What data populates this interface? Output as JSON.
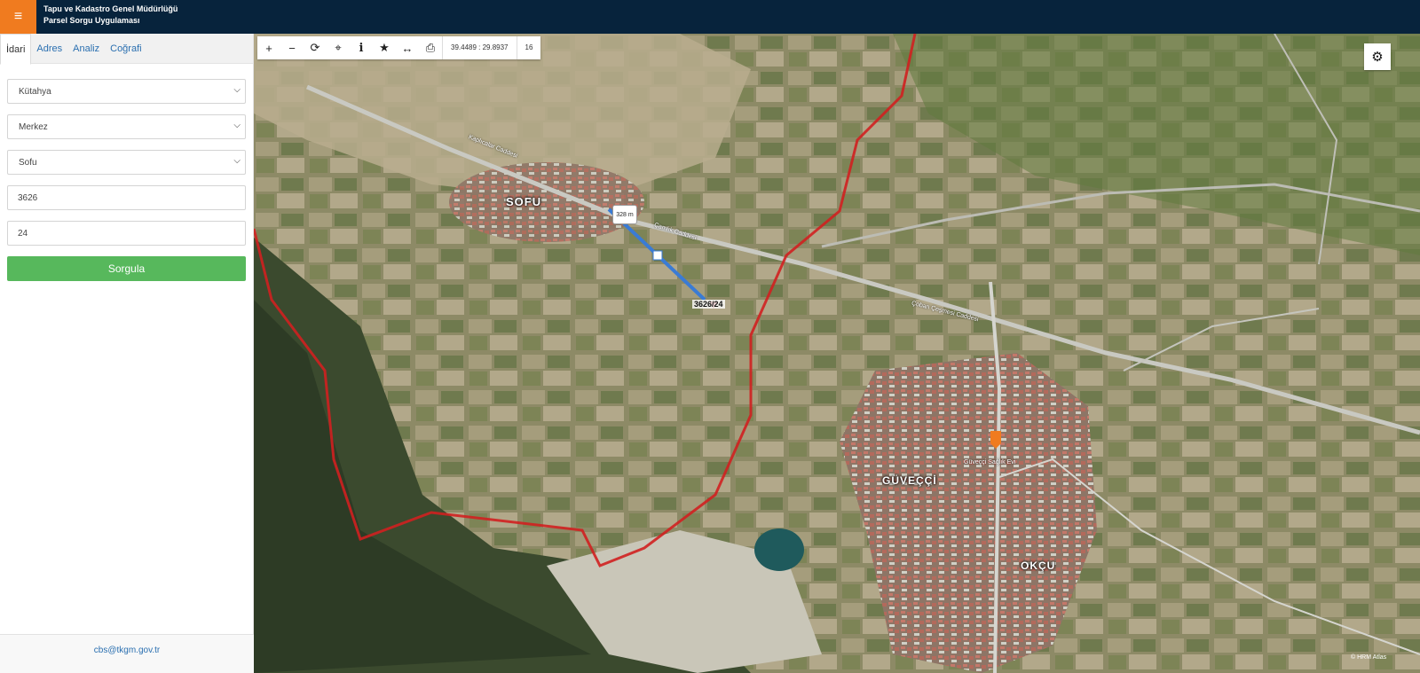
{
  "header": {
    "title_line1": "Tapu ve Kadastro Genel Müdürlüğü",
    "title_line2": "Parsel Sorgu Uygulaması",
    "menu_icon": "hamburger-icon"
  },
  "sidebar": {
    "tabs": [
      {
        "label": "İdari"
      },
      {
        "label": "Adres"
      },
      {
        "label": "Analiz"
      },
      {
        "label": "Coğrafi"
      }
    ],
    "il": "Kütahya",
    "ilce": "Merkez",
    "mahalle": "Sofu",
    "ada": "3626",
    "parsel": "24",
    "submit_label": "Sorgula",
    "footer_email": "cbs@tkgm.gov.tr"
  },
  "toolbar": {
    "coordinates": "39.4489 : 29.8937",
    "zoom_level": "16"
  },
  "map": {
    "labels": {
      "sofu": "SOFU",
      "guvecci": "GÜVEÇÇİ",
      "okcu": "OKÇU"
    },
    "streets": {
      "s1": "Kaplıcalar Caddesi",
      "s2": "Çamlık Caddesi",
      "s3": "Çoban Çeşmesi Caddesi",
      "s4": "Güveççi Sağlık Evi"
    },
    "distance": "328 m",
    "parcel": "3626/24",
    "attribution": "© HRM Atlas"
  }
}
